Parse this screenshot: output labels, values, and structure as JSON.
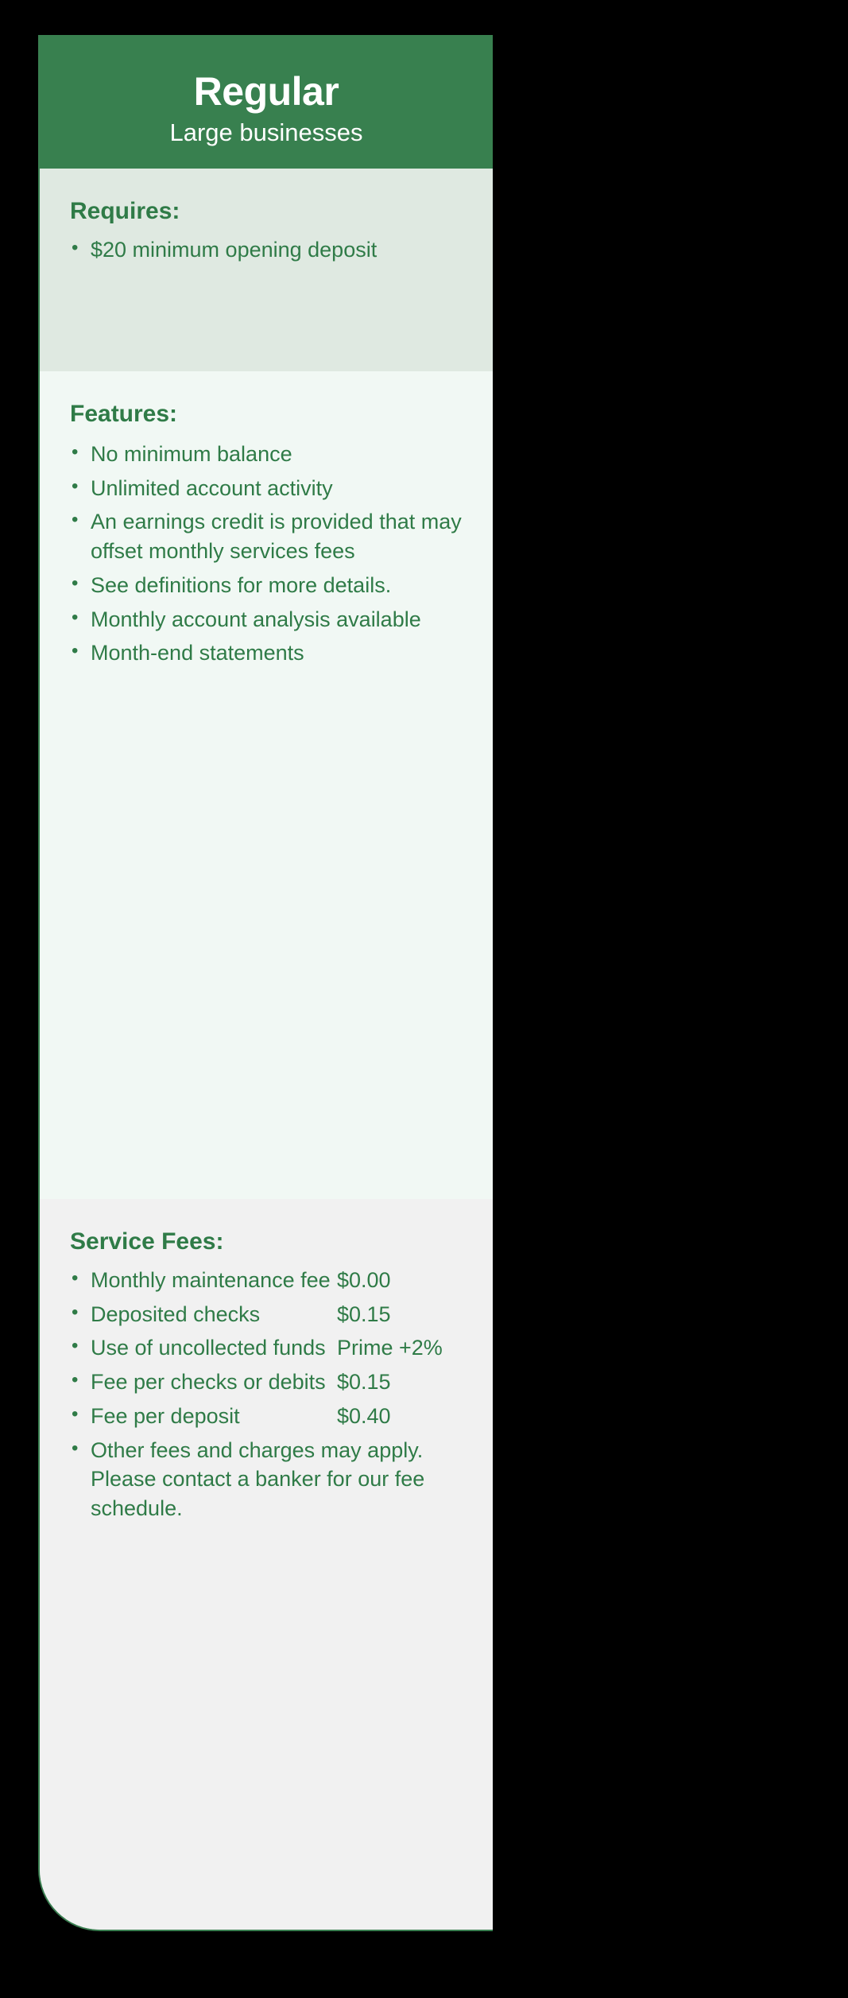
{
  "colors": {
    "page_background": "#000000",
    "header_green": "#38804f",
    "accent_green": "#2f7b47",
    "border_green": "#3a7f51",
    "requires_panel_bg": "#dfe9e1",
    "features_panel_bg": "#f1f8f4",
    "fees_panel_bg": "#f1f1f1",
    "header_text": "#ffffff"
  },
  "card": {
    "header": {
      "title": "Regular",
      "subtitle": "Large businesses"
    },
    "requires": {
      "heading": "Requires:",
      "items": [
        "$20 minimum opening deposit"
      ]
    },
    "features": {
      "heading": "Features:",
      "items": [
        "No minimum balance",
        "Unlimited account activity",
        "An earnings credit is provided that may offset monthly services fees",
        "See definitions for more details.",
        "Monthly account analysis available",
        "Month-end statements"
      ]
    },
    "service_fees": {
      "heading": "Service Fees:",
      "rows": [
        {
          "label": "Monthly maintenance fee",
          "value": "$0.00"
        },
        {
          "label": "Deposited checks",
          "value": "$0.15"
        },
        {
          "label": "Use of uncollected funds",
          "value": "Prime +2%"
        },
        {
          "label": "Fee per checks or debits",
          "value": "$0.15"
        },
        {
          "label": "Fee per deposit",
          "value": "$0.40"
        }
      ],
      "note": "Other fees and charges may apply. Please contact a banker for our fee schedule."
    }
  }
}
